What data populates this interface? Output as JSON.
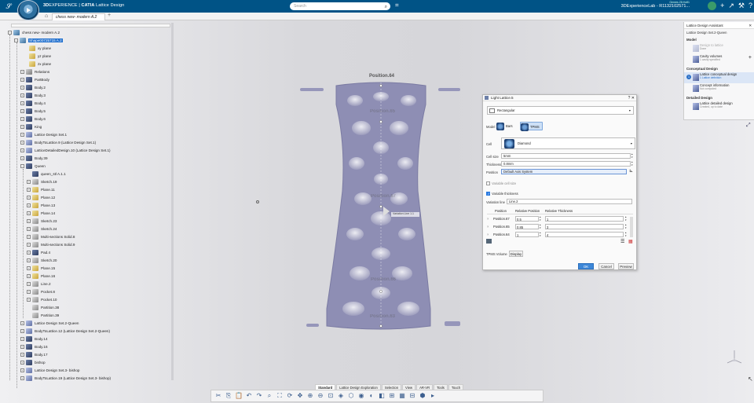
{
  "header": {
    "brand_prefix": "3D",
    "brand_mid": "EXPERIENCE",
    "brand_sep": " | ",
    "brand_app": "CATIA",
    "app_name": "Lattice Design",
    "search_placeholder": "Search",
    "user_name": "Genres Z8:Hz81",
    "context": "3DExperienceLab - R1132102571..."
  },
  "tab": {
    "label": "chess new- modern A.2",
    "add": "+"
  },
  "tree": {
    "nodes": [
      {
        "label": "chess new- modern A.2",
        "icon": "part",
        "toggle": "−"
      },
      {
        "label": "Shape00725715 A.2",
        "icon": "part",
        "toggle": "−",
        "selected": true
      },
      {
        "label": "xy plane",
        "icon": "plane"
      },
      {
        "label": "yz plane",
        "icon": "plane"
      },
      {
        "label": "zx plane",
        "icon": "plane"
      },
      {
        "label": "Relations",
        "icon": "rel",
        "toggle": "+"
      },
      {
        "label": "PartBody",
        "icon": "body",
        "toggle": "+"
      },
      {
        "label": "Body.2",
        "icon": "body",
        "toggle": "+"
      },
      {
        "label": "Body.3",
        "icon": "body",
        "toggle": "+"
      },
      {
        "label": "Body.4",
        "icon": "body",
        "toggle": "+"
      },
      {
        "label": "Body.5",
        "icon": "body",
        "toggle": "+"
      },
      {
        "label": "Body.6",
        "icon": "body",
        "toggle": "+"
      },
      {
        "label": "King",
        "icon": "body",
        "toggle": "+"
      },
      {
        "label": "Lattice Design Set.1",
        "icon": "lattice",
        "toggle": "+"
      },
      {
        "label": "BodyToLattice.9 (Lattice Design Set.1)",
        "icon": "lattice",
        "toggle": "+"
      },
      {
        "label": "LatticeDetailedDesign.10 (Lattice Design Set.1)",
        "icon": "lattice",
        "toggle": "+"
      },
      {
        "label": "Body.39",
        "icon": "body",
        "toggle": "+"
      },
      {
        "label": "Queen",
        "icon": "body",
        "toggle": "−"
      },
      {
        "label": "queen_stl A.1.1",
        "icon": "body"
      },
      {
        "label": "Sketch.19",
        "icon": "sketch",
        "toggle": "+"
      },
      {
        "label": "Plane.11",
        "icon": "plane",
        "toggle": "+"
      },
      {
        "label": "Plane.12",
        "icon": "plane",
        "toggle": "+"
      },
      {
        "label": "Plane.13",
        "icon": "plane",
        "toggle": "+"
      },
      {
        "label": "Plane.14",
        "icon": "plane",
        "toggle": "+"
      },
      {
        "label": "Sketch.23",
        "icon": "sketch",
        "toggle": "+"
      },
      {
        "label": "Sketch.24",
        "icon": "sketch",
        "toggle": "+"
      },
      {
        "label": "Multi-sections Solid.8",
        "icon": "sketch",
        "toggle": "+"
      },
      {
        "label": "Multi-sections Solid.9",
        "icon": "sketch",
        "toggle": "+"
      },
      {
        "label": "Pad.4",
        "icon": "body",
        "toggle": "+"
      },
      {
        "label": "Sketch.20",
        "icon": "sketch",
        "toggle": "+"
      },
      {
        "label": "Plane.15",
        "icon": "plane",
        "toggle": "+"
      },
      {
        "label": "Plane.16",
        "icon": "plane",
        "toggle": "+"
      },
      {
        "label": "Line.2",
        "icon": "sketch",
        "toggle": "+"
      },
      {
        "label": "Pocket.8",
        "icon": "sketch",
        "toggle": "+"
      },
      {
        "label": "Pocket.10",
        "icon": "sketch",
        "toggle": "+"
      },
      {
        "label": "Partition.38",
        "icon": "sketch"
      },
      {
        "label": "Partition.39",
        "icon": "sketch"
      },
      {
        "label": "Lattice Design Set.2-Queen",
        "icon": "lattice",
        "toggle": "+"
      },
      {
        "label": "BodyToLattice.12 (Lattice Design Set.2-Queen)",
        "icon": "lattice",
        "toggle": "+"
      },
      {
        "label": "Body.14",
        "icon": "body",
        "toggle": "+"
      },
      {
        "label": "Body.16",
        "icon": "body",
        "toggle": "+"
      },
      {
        "label": "Body.17",
        "icon": "body",
        "toggle": "+"
      },
      {
        "label": "bishop",
        "icon": "body",
        "toggle": "+"
      },
      {
        "label": "Lattice Design Set.3- bishop",
        "icon": "lattice",
        "toggle": "+"
      },
      {
        "label": "BodyToLattice.19 (Lattice Design Set.3- bishop)",
        "icon": "lattice",
        "toggle": "+"
      }
    ]
  },
  "viewport": {
    "labels": {
      "pos64_top": "Position.64",
      "pos65": "Position.65",
      "pos67": "Position.67",
      "pos66": "Position.66",
      "pos63": "Position.63"
    },
    "var_tag": "Variation Line 1.1"
  },
  "dialog": {
    "title": "Light Lattice.5",
    "help": "?",
    "close": "✕",
    "type": "Rectangular",
    "model_label": "Model",
    "model_bars": "Bars",
    "model_tpms": "TPMS",
    "cell_label": "Cell",
    "cell_value": "Diamond",
    "cell_size_label": "Cell size",
    "cell_size_value": "5mm",
    "thickness_label": "Thickness",
    "thickness_value": "0.8mm",
    "position_label": "Position",
    "position_value": "Default Axis System",
    "variable_cell_size": "Variable cell size",
    "variable_thickness": "Variable thickness",
    "variation_line_label": "Variation line",
    "variation_line_value": "Line.2",
    "table_headers": {
      "position": "Position",
      "relpos": "Relative Position",
      "relthick": "Relative Thickness"
    },
    "rows": [
      {
        "position": "Position.67",
        "relpos": "0.5",
        "relthick": "1"
      },
      {
        "position": "Position.65",
        "relpos": "0.85",
        "relthick": "3"
      },
      {
        "position": "Position.64",
        "relpos": "1",
        "relthick": "4"
      }
    ],
    "tpms_volume_label": "TPMS Volume",
    "tpms_volume_btn": "Display",
    "ok": "OK",
    "cancel": "Cancel",
    "preview": "Preview"
  },
  "assistant": {
    "title": "Lattice Design Assistant",
    "subtitle": "Lattice Design Set.2-Queen",
    "model_section": "Model",
    "design_to_lattice": "Design to lattice",
    "design_to_lattice_sub": "Done",
    "cavity_volumes": "Cavity volumes",
    "cavity_volumes_sub": "1 cavity specified",
    "conceptual_section": "Conceptual Design",
    "lattice_conceptual": "Lattice conceptual design",
    "lattice_conceptual_sub": "1 Lattice definition",
    "concept_information": "Concept information",
    "concept_information_sub": "Not computed",
    "detailed_section": "Detailed Design",
    "lattice_detailed": "Lattice detailed design",
    "lattice_detailed_sub": "Created, up to date",
    "step_num": "1"
  },
  "action_tabs": [
    "Standard",
    "Lattice Design Exploration",
    "Selection",
    "View",
    "AR-VR",
    "Tools",
    "Touch"
  ],
  "colors": {
    "topbar": "#005386",
    "accent": "#3d87d8",
    "lattice": "#8f8fb4"
  }
}
